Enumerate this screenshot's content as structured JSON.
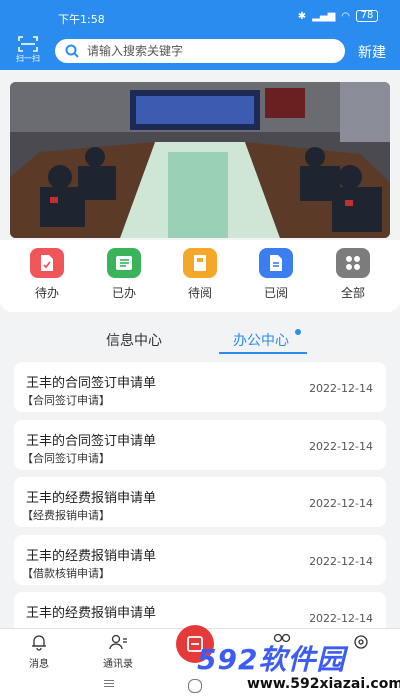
{
  "status": {
    "time": "下午1:58",
    "battery": "78"
  },
  "header": {
    "scan_label": "扫一扫",
    "search_placeholder": "请输入搜索关键字",
    "new_label": "新建"
  },
  "quick": [
    {
      "label": "待办",
      "icon": "todo-doc-icon",
      "color": "#f0555a"
    },
    {
      "label": "已办",
      "icon": "done-list-icon",
      "color": "#3bb35b"
    },
    {
      "label": "待阅",
      "icon": "to-read-book-icon",
      "color": "#f3a829"
    },
    {
      "label": "已阅",
      "icon": "read-doc-icon",
      "color": "#3a7ef0"
    },
    {
      "label": "全部",
      "icon": "grid-all-icon",
      "color": "#7c7c7c"
    }
  ],
  "tabs": [
    {
      "label": "信息中心",
      "active": false
    },
    {
      "label": "办公中心",
      "active": true
    }
  ],
  "items": [
    {
      "title": "王丰的合同签订申请单",
      "sub": "【合同签订申请】",
      "date": "2022-12-14"
    },
    {
      "title": "王丰的合同签订申请单",
      "sub": "【合同签订申请】",
      "date": "2022-12-14"
    },
    {
      "title": "王丰的经费报销申请单",
      "sub": "【经费报销申请】",
      "date": "2022-12-14"
    },
    {
      "title": "王丰的经费报销申请单",
      "sub": "【借款核销申请】",
      "date": "2022-12-14"
    },
    {
      "title": "王丰的经费报销申请单",
      "sub": "",
      "date": "2022-12-14"
    }
  ],
  "nav": {
    "messages": "消息",
    "contacts": "通讯录"
  },
  "watermark": {
    "text": "592软件园",
    "url": "www.592xiazai.com"
  },
  "colors": {
    "accent": "#2b8cf0",
    "center_button": "#e63a3a"
  }
}
